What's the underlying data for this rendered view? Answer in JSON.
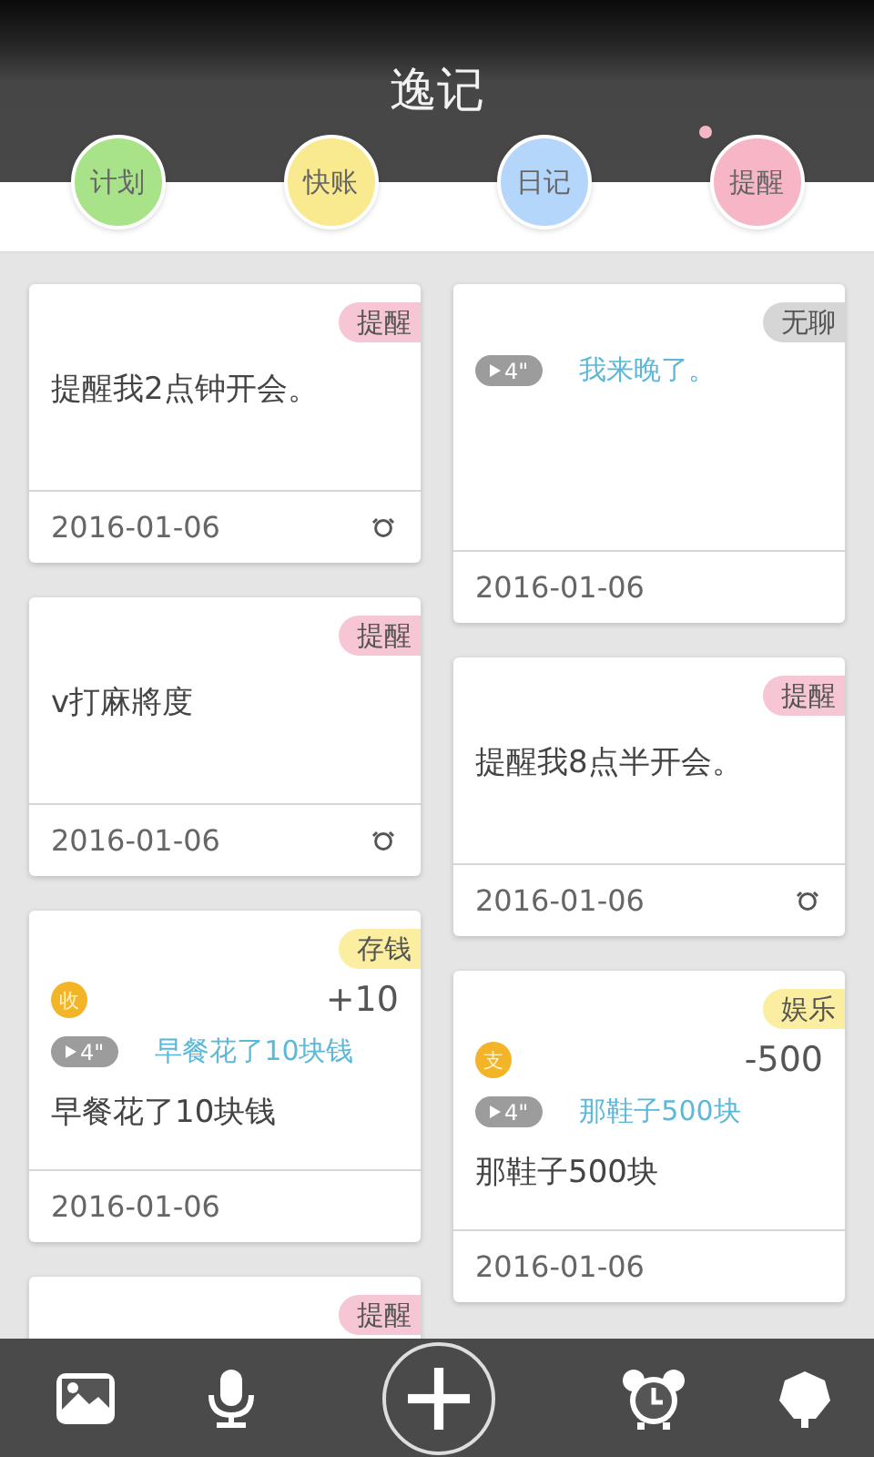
{
  "header": {
    "title": "逸记"
  },
  "categories": [
    {
      "label": "计划",
      "color": "#a8e38a",
      "notice": false
    },
    {
      "label": "快账",
      "color": "#f9e98f",
      "notice": false
    },
    {
      "label": "日记",
      "color": "#b5d6fb",
      "notice": false
    },
    {
      "label": "提醒",
      "color": "#f7b6c6",
      "notice": true
    }
  ],
  "columns": [
    [
      {
        "kind": "memo",
        "tag": {
          "label": "提醒",
          "color": "#f7c6d4"
        },
        "text": "提醒我2点钟开会。",
        "date": "2016-01-06",
        "alarm": true
      },
      {
        "kind": "memo",
        "tag": {
          "label": "提醒",
          "color": "#f7c6d4"
        },
        "text": "v打麻將度",
        "date": "2016-01-06",
        "alarm": true
      },
      {
        "kind": "money",
        "tag": {
          "label": "存钱",
          "color": "#fbeea0"
        },
        "flow": "收",
        "amount": "+10",
        "duration": "4\"",
        "transcript": "早餐花了10块钱",
        "text": "早餐花了10块钱",
        "date": "2016-01-06",
        "alarm": false
      },
      {
        "kind": "memo",
        "tag": {
          "label": "提醒",
          "color": "#f7c6d4"
        }
      }
    ],
    [
      {
        "kind": "voice",
        "tag": {
          "label": "无聊",
          "color": "#d6d6d6"
        },
        "duration": "4\"",
        "transcript": "我来晚了。",
        "date": "2016-01-06",
        "alarm": false
      },
      {
        "kind": "memo",
        "tag": {
          "label": "提醒",
          "color": "#f7c6d4"
        },
        "text": "提醒我8点半开会。",
        "date": "2016-01-06",
        "alarm": true
      },
      {
        "kind": "money",
        "tag": {
          "label": "娱乐",
          "color": "#fbeea0"
        },
        "flow": "支",
        "amount": "-500",
        "duration": "4\"",
        "transcript": "那鞋子500块",
        "text": "那鞋子500块",
        "date": "2016-01-06",
        "alarm": false
      }
    ]
  ]
}
